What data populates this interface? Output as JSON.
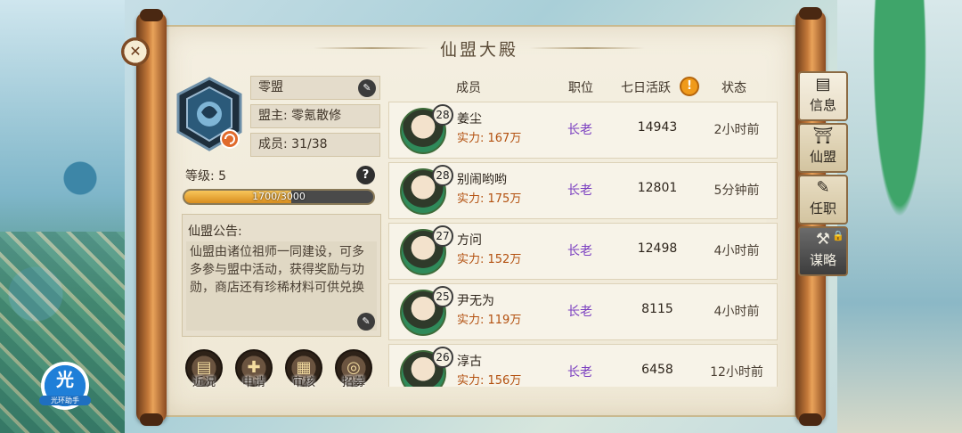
{
  "title": "仙盟大殿",
  "guild": {
    "name": "零盟",
    "leader_label": "盟主:",
    "leader": "零氪散修",
    "members_label": "成员:",
    "members": "31/38",
    "level_label": "等级:",
    "level": "5",
    "exp_text": "1700/3000",
    "exp_fraction": 0.567
  },
  "notice": {
    "title": "仙盟公告:",
    "body": "仙盟由诸位祖师一同建设，可多多参与盟中活动，获得奖励与功勋，商店还有珍稀材料可供兑换"
  },
  "actions": [
    {
      "label": "近况",
      "icon": "scroll-icon"
    },
    {
      "label": "申请",
      "icon": "apply-icon"
    },
    {
      "label": "审核",
      "icon": "review-icon"
    },
    {
      "label": "招募",
      "icon": "recruit-icon"
    }
  ],
  "table": {
    "headers": {
      "member": "成员",
      "role": "职位",
      "active": "七日活跃",
      "status": "状态"
    },
    "rows": [
      {
        "level": "28",
        "name": "姜尘",
        "power": "实力: 167万",
        "role": "长老",
        "active": "14943",
        "status": "2小时前"
      },
      {
        "level": "28",
        "name": "别闹哟哟",
        "power": "实力: 175万",
        "role": "长老",
        "active": "12801",
        "status": "5分钟前"
      },
      {
        "level": "27",
        "name": "方问",
        "power": "实力: 152万",
        "role": "长老",
        "active": "12498",
        "status": "4小时前"
      },
      {
        "level": "25",
        "name": "尹无为",
        "power": "实力: 119万",
        "role": "长老",
        "active": "8115",
        "status": "4小时前"
      },
      {
        "level": "26",
        "name": "淳古",
        "power": "实力: 156万",
        "role": "长老",
        "active": "6458",
        "status": "12小时前"
      }
    ]
  },
  "tabs": [
    {
      "label": "信息",
      "icon": "info-icon"
    },
    {
      "label": "仙盟",
      "icon": "palace-icon"
    },
    {
      "label": "任职",
      "icon": "appoint-icon"
    },
    {
      "label": "谋略",
      "icon": "strategy-icon"
    }
  ],
  "helper": {
    "char": "光",
    "label": "光环助手"
  }
}
